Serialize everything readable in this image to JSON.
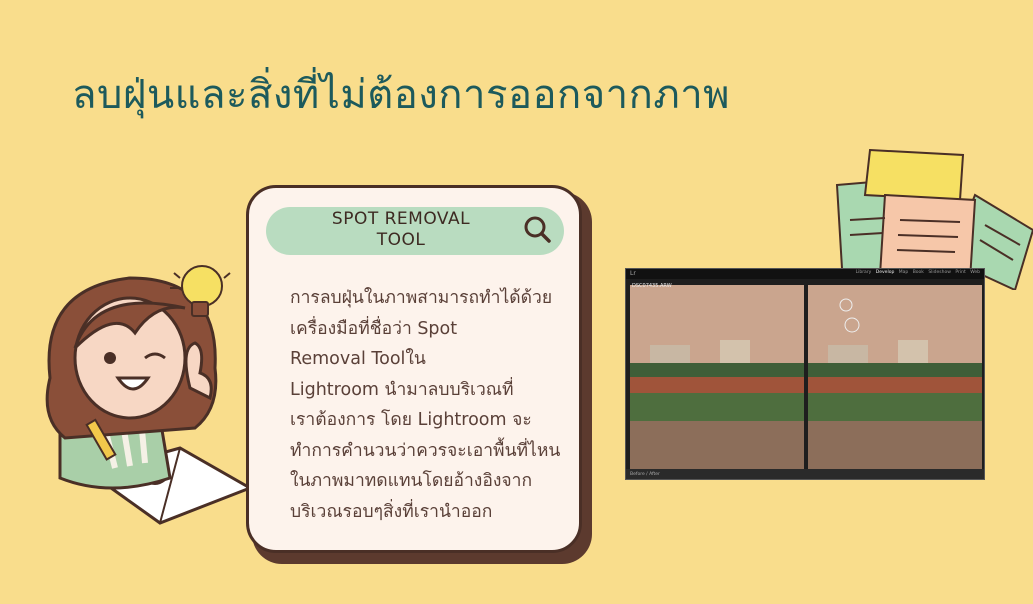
{
  "title": "ลบฝุ่นและสิ่งที่ไม่ต้องการออกจากภาพ",
  "card": {
    "heading": "SPOT REMOVAL TOOL",
    "heading_line1": "SPOT REMOVAL",
    "heading_line2": "TOOL",
    "body_lines": [
      "การลบฝุ่นในภาพสามารถทำได้ด้วย",
      "เครื่องมือที่ชื่อว่า Spot",
      "Removal Toolใน",
      "Lightroom นำมาลบบริเวณที่",
      "เราต้องการ โดย Lightroom จะ",
      "ทำการคำนวนว่าควรจะเอาพื้นที่ไหน",
      "ในภาพมาทดแทนโดยอ้างอิงจาก",
      "บริเวณรอบๆสิ่งที่เรานำออก"
    ]
  },
  "screenshot": {
    "logo": "Lr",
    "modules": [
      "Library",
      "Develop",
      "Map",
      "Book",
      "Slideshow",
      "Print",
      "Web"
    ],
    "active_module": "Develop",
    "photo_caption": "DSC07435.ARW",
    "before_after_label": "Before / After"
  },
  "colors": {
    "background": "#f9dd8c",
    "title": "#1d5a5c",
    "card_bg": "#fdf3ec",
    "card_border": "#4a2f26",
    "pill": "#b9dcc0"
  },
  "icons": [
    "search-icon",
    "lightbulb-icon",
    "sticky-notes-icon",
    "girl-illustration"
  ]
}
